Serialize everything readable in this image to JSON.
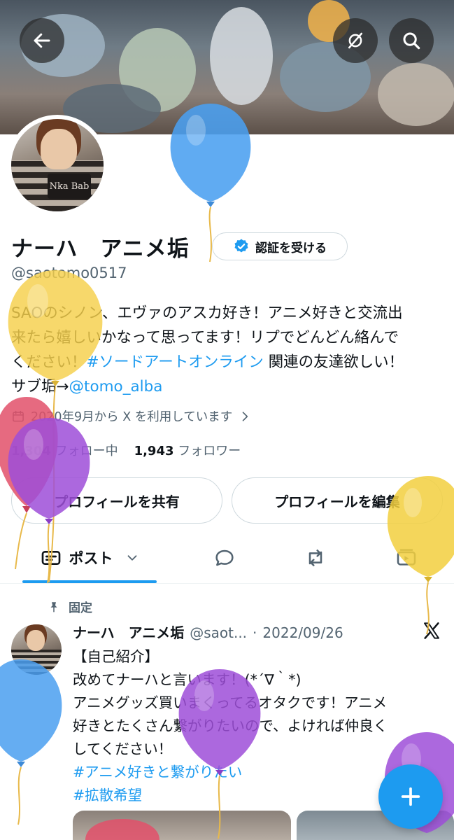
{
  "header": {
    "back_icon": "arrow-left-icon",
    "grok_icon": "slashed-circle-icon",
    "search_icon": "search-icon"
  },
  "profile": {
    "name": "ナーハ　アニメ垢",
    "verify_button_label": "認証を受ける",
    "handle": "@saotomo0517",
    "bio_line1": "SAOのシノン、エヴァのアスカ好き！アニメ好きと交流出",
    "bio_line2": "来たら嬉しいかなって思ってます！リプでどんどん絡んで",
    "bio_line3a": "ください！",
    "bio_hashtag": "#ソードアートオンライン",
    "bio_line3b": " 関連の友達欲しい！",
    "bio_line4a": "サブ垢→",
    "bio_mention": "@tomo_alba",
    "joined_text": "2020年9月から X を利用しています",
    "following_count": "1,304",
    "following_label": "フォロー中",
    "followers_count": "1,943",
    "followers_label": "フォロワー",
    "share_button_label": "プロフィールを共有",
    "edit_button_label": "プロフィールを編集",
    "avatar_sign_text": "Nka Bab"
  },
  "tabs": {
    "posts_label": "ポスト",
    "items": [
      "posts",
      "replies",
      "reposts",
      "videos"
    ]
  },
  "pinned_post": {
    "pinned_label": "固定",
    "author_name": "ナーハ　アニメ垢",
    "author_handle": "@saot...",
    "separator": "·",
    "date": "2022/09/26",
    "line1": "【自己紹介】",
    "line2": "改めてナーハと言います！(*´∇｀*)",
    "line3": "アニメグッズ買いまくってるオタクです！アニメ",
    "line4": "好きとたくさん繋がりたいので、よければ仲良く",
    "line5": "してください！",
    "hashtag1": "#アニメ好きと繋がりたい",
    "hashtag2": "#拡散希望"
  },
  "colors": {
    "accent": "#1d9bf0",
    "text_primary": "#0f1419",
    "text_secondary": "#536471",
    "border": "#cfd9de",
    "verify_badge": "#1d9bf0"
  },
  "balloons": [
    {
      "color": "#4a9ff0"
    },
    {
      "color": "#f5d04a"
    },
    {
      "color": "#e2506a"
    },
    {
      "color": "#9d4ed8"
    },
    {
      "color": "#f2cf3e"
    },
    {
      "color": "#4a9ff0"
    },
    {
      "color": "#9d4ed8"
    },
    {
      "color": "#9d4ed8"
    },
    {
      "color": "#e2506a"
    }
  ]
}
